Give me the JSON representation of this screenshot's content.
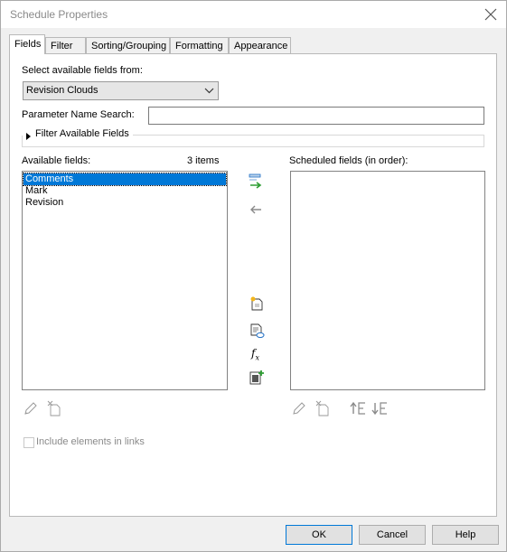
{
  "window": {
    "title": "Schedule Properties"
  },
  "tabs": [
    {
      "label": "Fields",
      "active": true
    },
    {
      "label": "Filter"
    },
    {
      "label": "Sorting/Grouping"
    },
    {
      "label": "Formatting"
    },
    {
      "label": "Appearance"
    }
  ],
  "fields": {
    "select_from_label": "Select available fields from:",
    "category_value": "Revision Clouds",
    "param_search_label": "Parameter Name Search:",
    "param_search_value": "",
    "filter_fields_label": "Filter Available Fields",
    "available_label": "Available fields:",
    "available_count": "3 items",
    "available_items": [
      "Comments",
      "Mark",
      "Revision"
    ],
    "scheduled_label": "Scheduled fields (in order):",
    "scheduled_items": [],
    "include_links_label": "Include elements in links",
    "include_links_checked": false
  },
  "icons": {
    "add_field": "add-parameter-icon",
    "remove_field": "remove-parameter-icon",
    "new_parameter": "new-parameter-icon",
    "add_calculated": "calculated-value-icon",
    "combine": "combine-parameters-icon",
    "edit": "pencil-icon",
    "delete": "delete-parameter-icon",
    "move_up": "move-up-icon",
    "move_down": "move-down-icon"
  },
  "colors": {
    "selection": "#0078d7",
    "accent_green": "#2e9d33",
    "accent_blue": "#1f6fc5"
  },
  "buttons": {
    "ok": "OK",
    "cancel": "Cancel",
    "help": "Help"
  }
}
